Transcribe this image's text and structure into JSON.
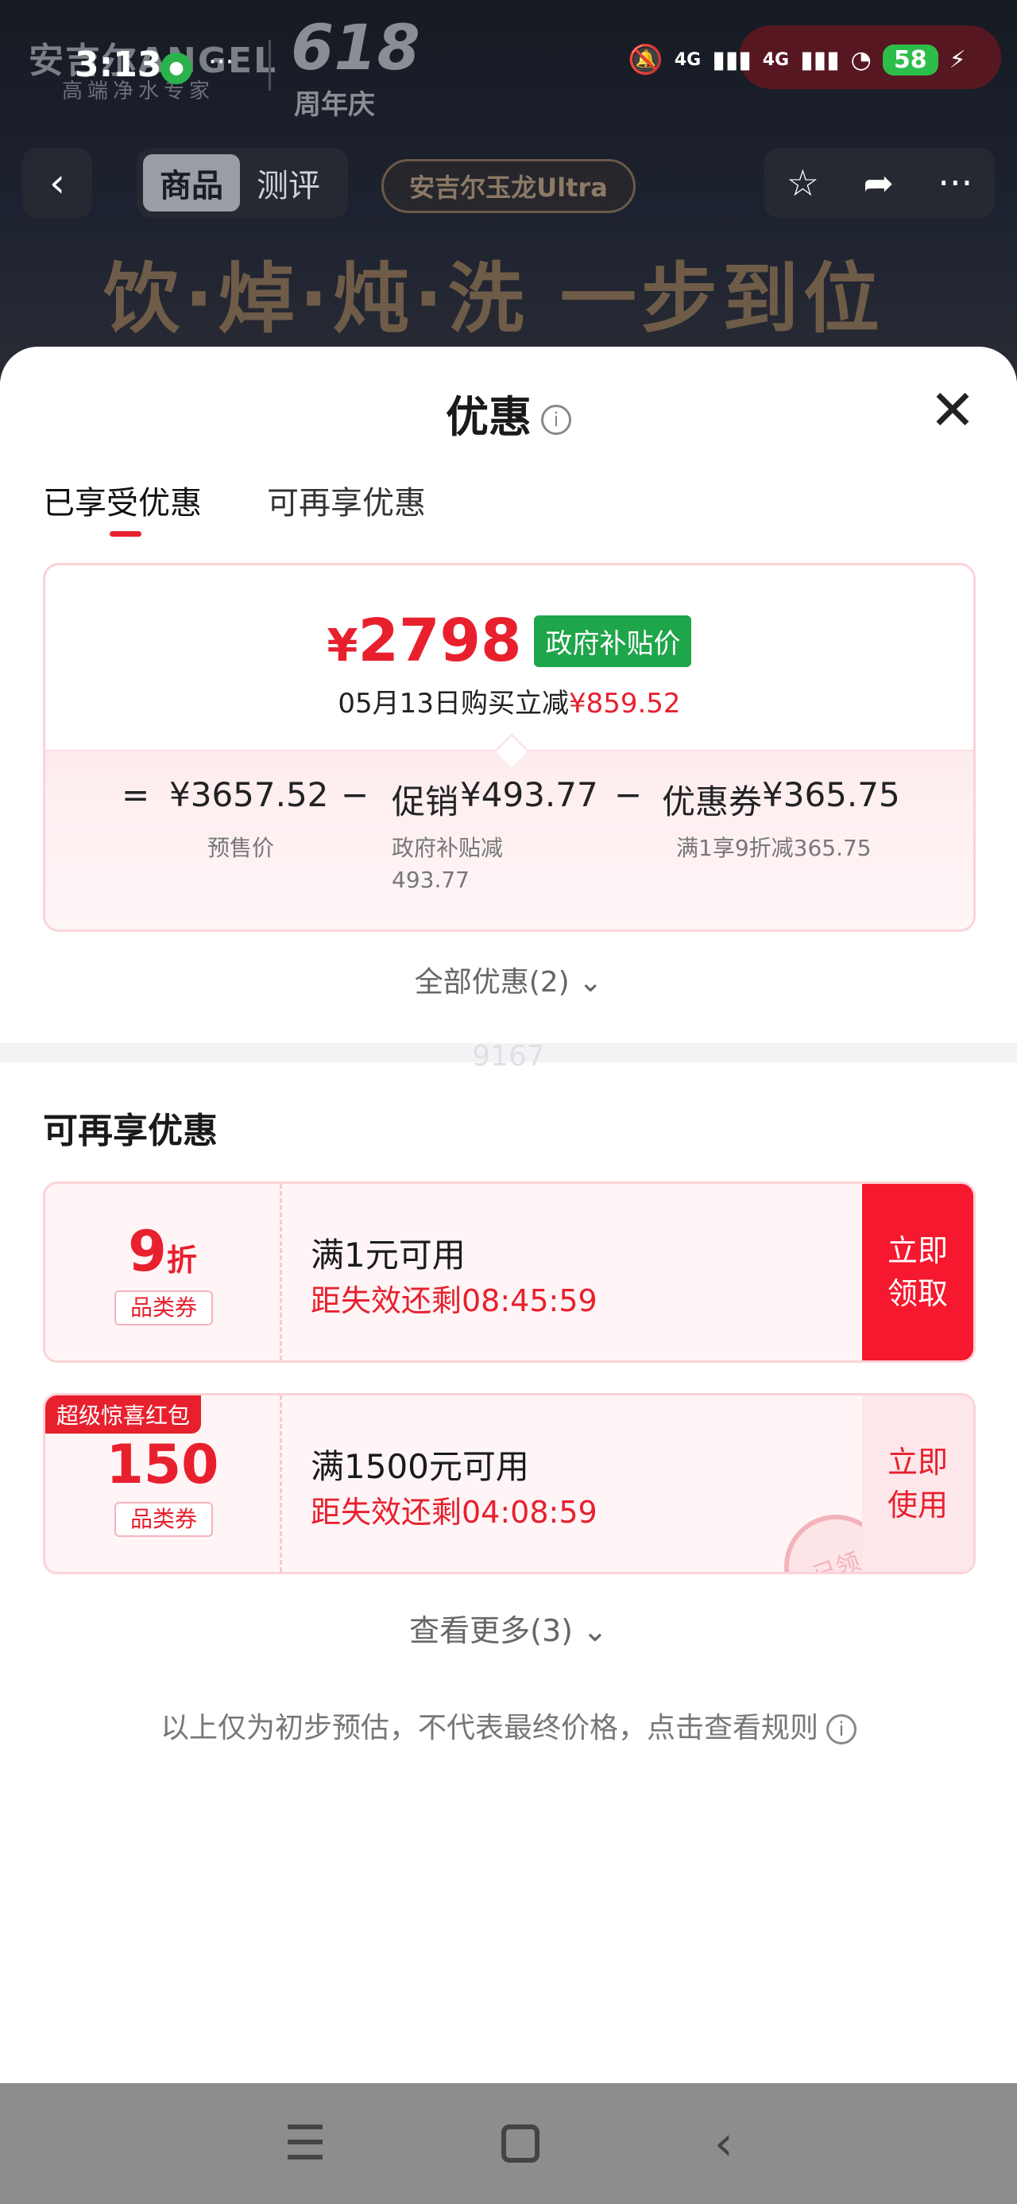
{
  "status_bar": {
    "time": "3:13",
    "more": "···",
    "battery": "58",
    "net1": "4G",
    "net2": "4G"
  },
  "brand": {
    "logo": "安吉尔ANGEL",
    "tagline": "高端净水专家",
    "event_number": "618",
    "event_text": "周年庆"
  },
  "nav": {
    "tabs": [
      "商品",
      "测评"
    ],
    "product_badge": "安吉尔玉龙Ultra",
    "headline": "饮·焯·炖·洗 一步到位"
  },
  "sheet": {
    "title": "优惠",
    "close": "✕",
    "tabs": [
      "已享受优惠",
      "可再享优惠"
    ]
  },
  "summary": {
    "price_symbol": "¥",
    "price": "2798",
    "tag": "政府补贴价",
    "save_prefix": "05月13日购买立减",
    "save_amount": "¥859.52",
    "eq": "=",
    "presale_price": "¥3657.52",
    "presale_label": "预售价",
    "minus1": "−",
    "promo_label": "促销",
    "promo_amount": "¥493.77",
    "promo_desc": "政府补贴减\n493.77",
    "minus2": "−",
    "coupon_label": "优惠券",
    "coupon_amount": "¥365.75",
    "coupon_desc": "满1享9折减365.75"
  },
  "all_discount": "全部优惠(2) ⌄",
  "watermark": "9167",
  "more_section": {
    "title": "可再享优惠",
    "coupons": [
      {
        "amount": "9",
        "unit": "折",
        "category": "品类券",
        "condition": "满1元可用",
        "timer": "距失效还剩08:45:59",
        "action": "立即\n领取"
      },
      {
        "ribbon": "超级惊喜红包",
        "amount": "150",
        "category": "品类券",
        "condition": "满1500元可用",
        "timer": "距失效还剩04:08:59",
        "action": "立即\n使用",
        "stamp": "已领"
      }
    ],
    "view_more": "查看更多(3) ⌄"
  },
  "disclaimer": "以上仅为初步预估，不代表最终价格，点击查看规则",
  "colors": {
    "accent_red": "#e8202e",
    "gov_green": "#1fa54a"
  }
}
